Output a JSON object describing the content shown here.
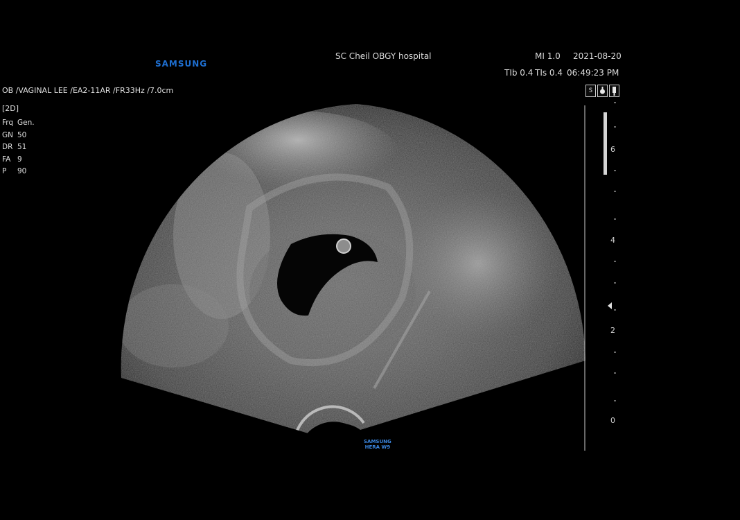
{
  "header": {
    "brand": "SAMSUNG",
    "hospital": "SC Cheil OBGY hospital",
    "mi": "MI 1.0",
    "date": "2021-08-20",
    "tib": "TIb 0.4",
    "tis": "TIs 0.4",
    "time": "06:49:23 PM"
  },
  "probe_line": "OB /VAGINAL LEE /EA2-11AR /FR33Hz /7.0cm",
  "mode": "[2D]",
  "params": [
    {
      "key": "Frq",
      "value": "Gen."
    },
    {
      "key": "GN",
      "value": "50"
    },
    {
      "key": "DR",
      "value": "51"
    },
    {
      "key": "FA",
      "value": "9"
    },
    {
      "key": "P",
      "value": "90"
    }
  ],
  "icons": [
    "S",
    "cine-icon",
    "probe-icon"
  ],
  "icon_text": {
    "first": "S"
  },
  "depth_scale": [
    "6",
    "4",
    "2",
    "0"
  ],
  "probe_brand": {
    "line1": "SAMSUNG",
    "line2": "HERA W9"
  }
}
